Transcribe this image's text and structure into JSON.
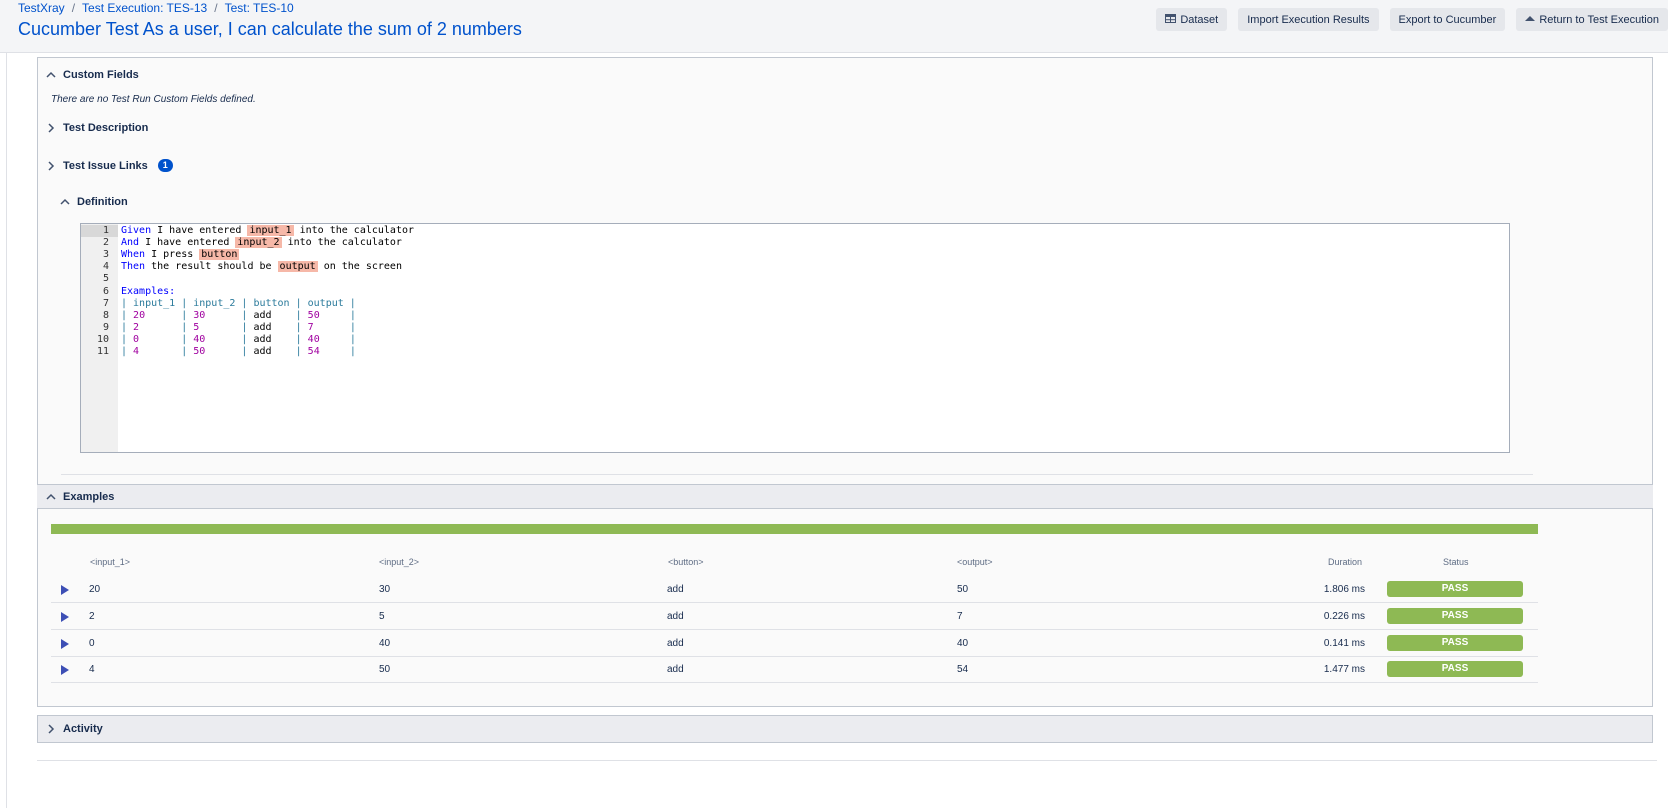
{
  "breadcrumb": [
    "TestXray",
    "Test Execution: TES-13",
    "Test: TES-10"
  ],
  "page_title": "Cucumber Test As a user, I can calculate the sum of 2 numbers",
  "toolbar": {
    "dataset": "Dataset",
    "import": "Import Execution Results",
    "export": "Export to Cucumber",
    "return": "Return to Test Execution"
  },
  "sections": {
    "custom_fields": "Custom Fields",
    "custom_fields_note": "There are no Test Run Custom Fields defined.",
    "test_description": "Test Description",
    "test_issue_links": "Test Issue Links",
    "issue_links_count": "1",
    "definition": "Definition",
    "examples": "Examples",
    "activity": "Activity"
  },
  "definition": {
    "line_numbers": [
      "1",
      "2",
      "3",
      "4",
      "5",
      "6",
      "7",
      "8",
      "9",
      "10",
      "11"
    ],
    "lines": [
      [
        {
          "t": "kw",
          "v": "Given"
        },
        {
          "t": "",
          "v": " I have entered "
        },
        {
          "t": "hl",
          "v": "input_1"
        },
        {
          "t": "",
          "v": " into the calculator"
        }
      ],
      [
        {
          "t": "kw",
          "v": "And"
        },
        {
          "t": "",
          "v": " I have entered "
        },
        {
          "t": "hl",
          "v": "input_2"
        },
        {
          "t": "",
          "v": " into the calculator"
        }
      ],
      [
        {
          "t": "kw",
          "v": "When"
        },
        {
          "t": "",
          "v": " I press "
        },
        {
          "t": "hl",
          "v": "button"
        }
      ],
      [
        {
          "t": "kw",
          "v": "Then"
        },
        {
          "t": "",
          "v": " the result should be "
        },
        {
          "t": "hl",
          "v": "output"
        },
        {
          "t": "",
          "v": " on the screen"
        }
      ],
      [],
      [
        {
          "t": "kw",
          "v": "Examples:"
        }
      ],
      [
        {
          "t": "tbl",
          "v": "| input_1 | input_2 | button | output |"
        }
      ],
      [
        {
          "t": "tbl",
          "v": "| "
        },
        {
          "t": "num",
          "v": "20"
        },
        {
          "t": "tbl",
          "v": "      | "
        },
        {
          "t": "num",
          "v": "30"
        },
        {
          "t": "tbl",
          "v": "      | "
        },
        {
          "t": "",
          "v": "add"
        },
        {
          "t": "tbl",
          "v": "    | "
        },
        {
          "t": "num",
          "v": "50"
        },
        {
          "t": "tbl",
          "v": "     |"
        }
      ],
      [
        {
          "t": "tbl",
          "v": "| "
        },
        {
          "t": "num",
          "v": "2"
        },
        {
          "t": "tbl",
          "v": "       | "
        },
        {
          "t": "num",
          "v": "5"
        },
        {
          "t": "tbl",
          "v": "       | "
        },
        {
          "t": "",
          "v": "add"
        },
        {
          "t": "tbl",
          "v": "    | "
        },
        {
          "t": "num",
          "v": "7"
        },
        {
          "t": "tbl",
          "v": "      |"
        }
      ],
      [
        {
          "t": "tbl",
          "v": "| "
        },
        {
          "t": "num",
          "v": "0"
        },
        {
          "t": "tbl",
          "v": "       | "
        },
        {
          "t": "num",
          "v": "40"
        },
        {
          "t": "tbl",
          "v": "      | "
        },
        {
          "t": "",
          "v": "add"
        },
        {
          "t": "tbl",
          "v": "    | "
        },
        {
          "t": "num",
          "v": "40"
        },
        {
          "t": "tbl",
          "v": "     |"
        }
      ],
      [
        {
          "t": "tbl",
          "v": "| "
        },
        {
          "t": "num",
          "v": "4"
        },
        {
          "t": "tbl",
          "v": "       | "
        },
        {
          "t": "num",
          "v": "50"
        },
        {
          "t": "tbl",
          "v": "      | "
        },
        {
          "t": "",
          "v": "add"
        },
        {
          "t": "tbl",
          "v": "    | "
        },
        {
          "t": "num",
          "v": "54"
        },
        {
          "t": "tbl",
          "v": "     |"
        }
      ]
    ]
  },
  "examples_table": {
    "progress_pass_fraction": 1.0,
    "headers": {
      "input_1": "<input_1>",
      "input_2": "<input_2>",
      "button": "<button>",
      "output": "<output>",
      "duration": "Duration",
      "status": "Status"
    },
    "rows": [
      {
        "input_1": "20",
        "input_2": "30",
        "button": "add",
        "output": "50",
        "duration": "1.806 ms",
        "status": "PASS"
      },
      {
        "input_1": "2",
        "input_2": "5",
        "button": "add",
        "output": "7",
        "duration": "0.226 ms",
        "status": "PASS"
      },
      {
        "input_1": "0",
        "input_2": "40",
        "button": "add",
        "output": "40",
        "duration": "0.141 ms",
        "status": "PASS"
      },
      {
        "input_1": "4",
        "input_2": "50",
        "button": "add",
        "output": "54",
        "duration": "1.477 ms",
        "status": "PASS"
      }
    ]
  },
  "colors": {
    "link": "#0052cc",
    "pass": "#8eb954",
    "highlight": "#f6b8a8"
  }
}
